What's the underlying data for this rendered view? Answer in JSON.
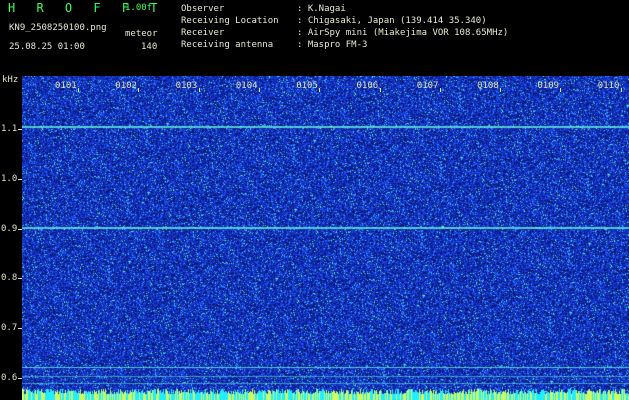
{
  "header": {
    "app_title": "H R O F F T",
    "version": "1.00f",
    "filename": "KN9_2508250100.png",
    "timestamp": "25.08.25 01:00",
    "meteor_label": "meteor",
    "meteor_count": "140",
    "observer_label": "Observer",
    "observer_value": ": K.Nagai",
    "location_label": "Receiving Location",
    "location_value": ": Chigasaki, Japan (139.414 35.340)",
    "receiver_label": "Receiver",
    "receiver_value": ": AirSpy mini (Miakejima VOR 108.65MHz)",
    "antenna_label": "Receiving antenna",
    "antenna_value": ": Maspro FM-3"
  },
  "y_axis": {
    "unit": "kHz",
    "ticks": [
      "1.1",
      "1.0",
      "0.9",
      "0.8",
      "0.7",
      "0.6"
    ]
  },
  "x_axis": {
    "ticks": [
      "0101",
      "0102",
      "0103",
      "0104",
      "0105",
      "0106",
      "0107",
      "0108",
      "0109",
      "0110"
    ]
  },
  "colors": {
    "background": "#0d1f8a",
    "signal": "#44ffcc",
    "noise_low": "#1a3cff",
    "noise_high": "#55ff99"
  }
}
